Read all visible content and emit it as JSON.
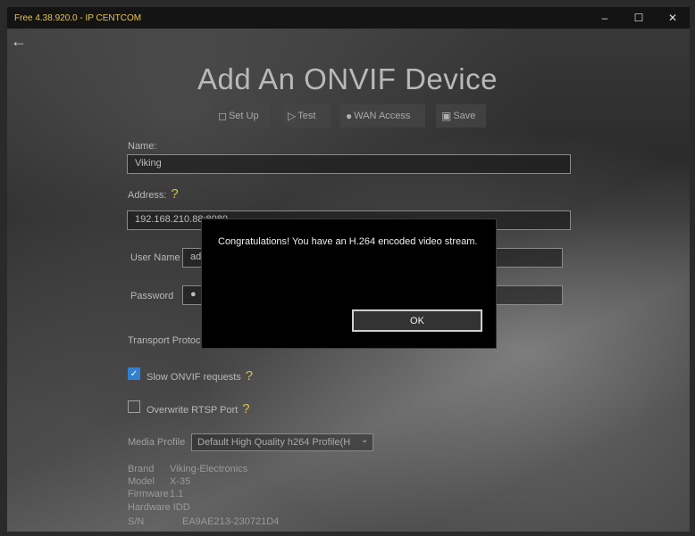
{
  "window": {
    "title": "Free 4.38.920.0 - IP CENTCOM",
    "minimize_icon": "minimize-icon",
    "maximize_icon": "maximize-icon",
    "close_icon": "close-icon"
  },
  "nav": {
    "back_icon": "back-arrow-icon"
  },
  "page": {
    "title": "Add An ONVIF Device"
  },
  "toolbar": {
    "setup_label": "Set Up",
    "test_label": "Test",
    "wan_label": "WAN Access",
    "save_label": "Save"
  },
  "form": {
    "name_label": "Name:",
    "name_value": "Viking",
    "address_label": "Address:",
    "address_help": "?",
    "address_value": "192.168.210.88:8080",
    "username_label": "User Name",
    "username_value": "ad",
    "password_label": "Password",
    "password_value": "●",
    "transport_label": "Transport Protoc",
    "slow_onvif_label": "Slow ONVIF requests",
    "slow_onvif_checked": true,
    "slow_onvif_help": "?",
    "overwrite_rtsp_label": "Overwrite RTSP Port",
    "overwrite_rtsp_checked": false,
    "overwrite_rtsp_help": "?",
    "media_profile_label": "Media Profile",
    "media_profile_value": "Default High Quality h264 Profile(H"
  },
  "device_info": {
    "brand_label": "Brand",
    "brand_value": "Viking-Electronics",
    "model_label": "Model",
    "model_value": "X-35",
    "firmware_label": "Firmware",
    "firmware_value": "1.1",
    "hardware_label": "Hardware IDD",
    "hardware_value": "",
    "sn_label": "S/N",
    "sn_value": "EA9AE213-230721D4"
  },
  "dialog": {
    "message": "Congratulations!  You have an H.264 encoded video stream.",
    "ok_label": "OK"
  }
}
